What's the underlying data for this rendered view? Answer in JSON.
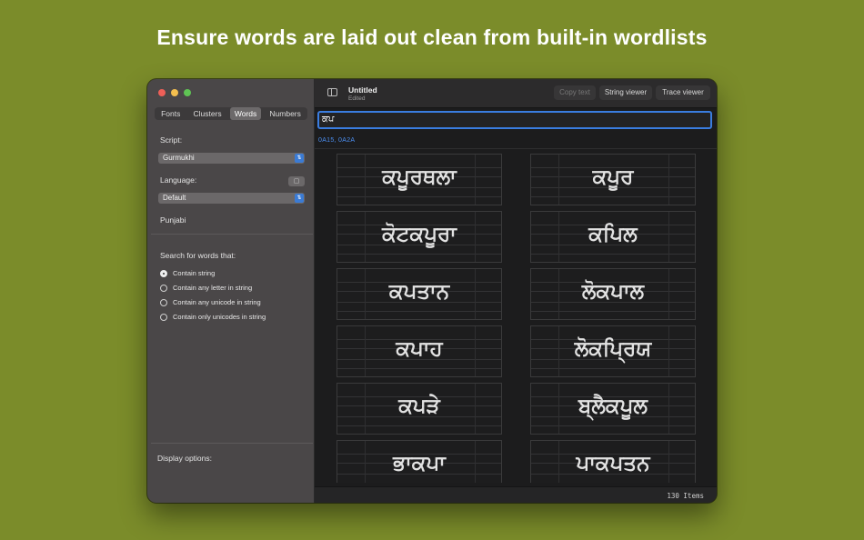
{
  "headline": "Ensure words are laid out clean from built-in wordlists",
  "window": {
    "title": "Untitled",
    "subtitle": "Edited"
  },
  "sidebar": {
    "tabs": [
      {
        "label": "Fonts",
        "active": false
      },
      {
        "label": "Clusters",
        "active": false
      },
      {
        "label": "Words",
        "active": true
      },
      {
        "label": "Numbers",
        "active": false
      }
    ],
    "script_label": "Script:",
    "script_value": "Gurmukhi",
    "language_label": "Language:",
    "language_value": "Default",
    "language_name": "Punjabi",
    "search_label": "Search for words that:",
    "options": [
      {
        "label": "Contain string",
        "selected": true
      },
      {
        "label": "Contain any letter in string",
        "selected": false
      },
      {
        "label": "Contain any unicode in string",
        "selected": false
      },
      {
        "label": "Contain only unicodes in string",
        "selected": false
      }
    ],
    "display_options_label": "Display options:"
  },
  "toolbar": {
    "copy_text": "Copy text",
    "string_viewer": "String viewer",
    "trace_viewer": "Trace viewer"
  },
  "search": {
    "value": "ਕਪ",
    "codepoints": "0A15, 0A2A"
  },
  "words": [
    "ਕਪੂਰਥਲਾ",
    "ਕਪੂਰ",
    "ਕੋਟਕਪੂਰਾ",
    "ਕਪਿਲ",
    "ਕਪਤਾਨ",
    "ਲੋਕਪਾਲ",
    "ਕਪਾਹ",
    "ਲੋਕਪ੍ਰਿਯ",
    "ਕਪੜੇ",
    "ਬ੍ਲੈਕਪੂਲ",
    "ਭਾਕਪਾ",
    "ਪਾਕਪਤਨ"
  ],
  "status": {
    "count": "130 Items"
  },
  "colors": {
    "background": "#7b8c2a",
    "accent": "#3a7de0"
  }
}
